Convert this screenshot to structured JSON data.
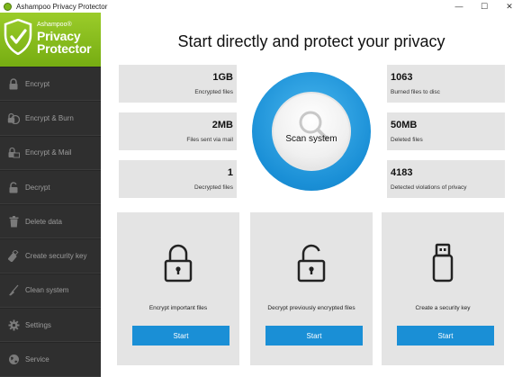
{
  "window": {
    "title": "Ashampoo Privacy Protector",
    "minimize_glyph": "—",
    "maximize_glyph": "☐",
    "close_glyph": "✕"
  },
  "logo": {
    "small": "Ashampoo®",
    "line1": "Privacy",
    "line2": "Protector",
    "color": "#8cc020"
  },
  "sidebar": {
    "items": [
      {
        "label": "Encrypt",
        "icon": "lock-icon"
      },
      {
        "label": "Encrypt & Burn",
        "icon": "lock-disc-icon"
      },
      {
        "label": "Encrypt & Mail",
        "icon": "lock-mail-icon"
      },
      {
        "label": "Decrypt",
        "icon": "unlock-icon"
      },
      {
        "label": "Delete data",
        "icon": "trash-icon"
      },
      {
        "label": "Create security key",
        "icon": "usb-key-icon"
      },
      {
        "label": "Clean system",
        "icon": "broom-icon"
      },
      {
        "label": "Settings",
        "icon": "gear-icon"
      },
      {
        "label": "Service",
        "icon": "globe-icon"
      }
    ]
  },
  "main": {
    "headline": "Start directly and protect your privacy",
    "scan_label": "Scan system",
    "accent": "#1a8fd6",
    "stats": {
      "encrypted": {
        "value": "1GB",
        "label": "Encrypted files"
      },
      "burned": {
        "value": "1063",
        "label": "Burned files to disc"
      },
      "sent_mail": {
        "value": "2MB",
        "label": "Files sent via mail"
      },
      "deleted": {
        "value": "50MB",
        "label": "Deleted files"
      },
      "decrypted": {
        "value": "1",
        "label": "Decrypted files"
      },
      "violations": {
        "value": "4183",
        "label": "Detected violations of privacy"
      }
    },
    "cards": [
      {
        "text": "Encrypt important files",
        "button": "Start",
        "icon": "padlock-closed-icon"
      },
      {
        "text": "Decrypt previously encrypted files",
        "button": "Start",
        "icon": "padlock-open-icon"
      },
      {
        "text": "Create a security key",
        "button": "Start",
        "icon": "usb-stick-icon"
      }
    ]
  }
}
